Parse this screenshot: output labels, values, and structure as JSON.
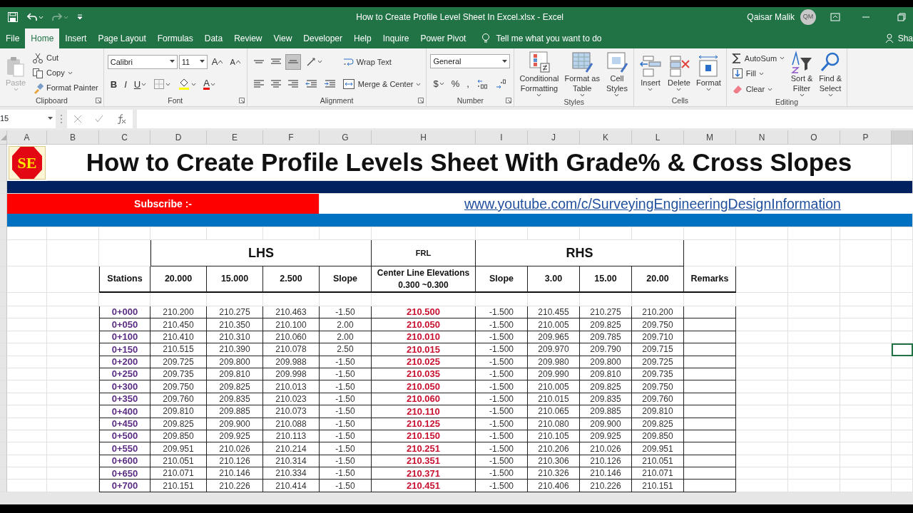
{
  "title_bar": {
    "title": "How to Create Profile Level Sheet In Excel.xlsx  -  Excel",
    "user": "Qaisar Malik",
    "avatar": "QM",
    "undo_enabled": true,
    "redo_enabled": false
  },
  "tabs": [
    {
      "label": "File",
      "selected": false
    },
    {
      "label": "Home",
      "selected": true
    },
    {
      "label": "Insert",
      "selected": false
    },
    {
      "label": "Page Layout",
      "selected": false
    },
    {
      "label": "Formulas",
      "selected": false
    },
    {
      "label": "Data",
      "selected": false
    },
    {
      "label": "Review",
      "selected": false
    },
    {
      "label": "View",
      "selected": false
    },
    {
      "label": "Developer",
      "selected": false
    },
    {
      "label": "Help",
      "selected": false
    },
    {
      "label": "Inquire",
      "selected": false
    },
    {
      "label": "Power Pivot",
      "selected": false
    }
  ],
  "tell_me": "Tell me what you want to do",
  "share": "Sha",
  "ribbon": [
    {
      "label": "Clipboard",
      "columns": [
        [
          [
            {
              "kind": "large",
              "lines": [
                "Paste"
              ],
              "disabled": true
            }
          ]
        ],
        [
          [
            {
              "kind": "small",
              "label": "Cut"
            }
          ],
          [
            {
              "kind": "small",
              "label": "Copy"
            }
          ],
          [
            {
              "kind": "small",
              "label": "Format Painter"
            }
          ]
        ]
      ]
    },
    {
      "label": "Font",
      "columns": [
        [
          [
            {
              "kind": "field",
              "value": "Calibri"
            },
            {
              "kind": "field",
              "value": "11"
            },
            {
              "kind": "glyph",
              "label": "A"
            },
            {
              "kind": "glyph",
              "label": "A"
            }
          ],
          [
            {
              "kind": "glyph",
              "label": "B"
            },
            {
              "kind": "glyph",
              "label": "I"
            },
            {
              "kind": "glyph",
              "label": "U"
            },
            {
              "kind": "icon"
            },
            {
              "kind": "icon"
            },
            {
              "kind": "glyph",
              "label": "A"
            }
          ]
        ]
      ]
    },
    {
      "label": "Alignment",
      "columns": [
        [
          [
            {
              "kind": "icon",
              "selected": false
            },
            {
              "kind": "icon",
              "selected": false
            },
            {
              "kind": "icon",
              "selected": true
            },
            {
              "kind": "icon"
            }
          ],
          [
            {
              "kind": "icon",
              "selected": false
            },
            {
              "kind": "icon",
              "selected": false
            },
            {
              "kind": "icon",
              "selected": false
            },
            {
              "kind": "icon"
            },
            {
              "kind": "icon"
            }
          ]
        ],
        [
          [
            {
              "kind": "small",
              "label": "Wrap Text"
            }
          ],
          [
            {
              "kind": "small",
              "label": "Merge & Center"
            }
          ]
        ]
      ]
    },
    {
      "label": "Number",
      "columns": [
        [
          [
            {
              "kind": "field",
              "value": "General"
            }
          ],
          [
            {
              "kind": "glyph",
              "label": "$"
            },
            {
              "kind": "glyph",
              "label": "%"
            },
            {
              "kind": "glyph",
              "label": ","
            },
            {
              "kind": "icon"
            },
            {
              "kind": "icon"
            }
          ]
        ]
      ]
    },
    {
      "label": "Styles",
      "columns": [
        [
          [
            {
              "kind": "large",
              "lines": [
                "Conditional",
                "Formatting"
              ],
              "disabled": false
            }
          ]
        ],
        [
          [
            {
              "kind": "large",
              "lines": [
                "Format as",
                "Table"
              ],
              "disabled": false
            }
          ]
        ],
        [
          [
            {
              "kind": "large",
              "lines": [
                "Cell",
                "Styles"
              ],
              "disabled": false
            }
          ]
        ]
      ]
    },
    {
      "label": "Cells",
      "columns": [
        [
          [
            {
              "kind": "large",
              "lines": [
                "Insert"
              ],
              "disabled": false
            }
          ]
        ],
        [
          [
            {
              "kind": "large",
              "lines": [
                "Delete"
              ],
              "disabled": false
            }
          ]
        ],
        [
          [
            {
              "kind": "large",
              "lines": [
                "Format"
              ],
              "disabled": false
            }
          ]
        ]
      ]
    },
    {
      "label": "Editing",
      "columns": [
        [
          [
            {
              "kind": "small",
              "label": "AutoSum"
            }
          ],
          [
            {
              "kind": "small",
              "label": "Fill"
            }
          ],
          [
            {
              "kind": "small",
              "label": "Clear"
            }
          ]
        ],
        [
          [
            {
              "kind": "large",
              "lines": [
                "Sort &",
                "Filter"
              ],
              "disabled": false
            }
          ]
        ],
        [
          [
            {
              "kind": "large",
              "lines": [
                "Find &",
                "Select"
              ],
              "disabled": false
            }
          ]
        ]
      ]
    }
  ],
  "name_box": "15",
  "columns": [
    "A",
    "B",
    "C",
    "D",
    "E",
    "F",
    "G",
    "H",
    "I",
    "J",
    "K",
    "L",
    "M",
    "N",
    "O",
    "P"
  ],
  "banner": {
    "logo": "SE",
    "title": "How to Create Profile Levels Sheet With Grade% & Cross Slopes",
    "subscribe": "Subscribe :-",
    "link": "www.youtube.com/c/SurveyingEngineeringDesignInformation"
  },
  "table": {
    "lhs": "LHS",
    "frl": "FRL",
    "rhs": "RHS",
    "stations": "Stations",
    "lhs_columns": [
      "20.000",
      "15.000",
      "2.500",
      "Slope"
    ],
    "center": [
      "Center Line Elevations",
      "0.300 ~0.300"
    ],
    "rhs_columns": [
      "Slope",
      "3.00",
      "15.00",
      "20.00"
    ],
    "remarks": "Remarks",
    "rows": [
      [
        "0+000",
        "210.200",
        "210.275",
        "210.463",
        "-1.50",
        "210.500",
        "-1.500",
        "210.455",
        "210.275",
        "210.200"
      ],
      [
        "0+050",
        "210.450",
        "210.350",
        "210.100",
        "2.00",
        "210.050",
        "-1.500",
        "210.005",
        "209.825",
        "209.750"
      ],
      [
        "0+100",
        "210.410",
        "210.310",
        "210.060",
        "2.00",
        "210.010",
        "-1.500",
        "209.965",
        "209.785",
        "209.710"
      ],
      [
        "0+150",
        "210.515",
        "210.390",
        "210.078",
        "2.50",
        "210.015",
        "-1.500",
        "209.970",
        "209.790",
        "209.715"
      ],
      [
        "0+200",
        "209.725",
        "209.800",
        "209.988",
        "-1.50",
        "210.025",
        "-1.500",
        "209.980",
        "209.800",
        "209.725"
      ],
      [
        "0+250",
        "209.735",
        "209.810",
        "209.998",
        "-1.50",
        "210.035",
        "-1.500",
        "209.990",
        "209.810",
        "209.735"
      ],
      [
        "0+300",
        "209.750",
        "209.825",
        "210.013",
        "-1.50",
        "210.050",
        "-1.500",
        "210.005",
        "209.825",
        "209.750"
      ],
      [
        "0+350",
        "209.760",
        "209.835",
        "210.023",
        "-1.50",
        "210.060",
        "-1.500",
        "210.015",
        "209.835",
        "209.760"
      ],
      [
        "0+400",
        "209.810",
        "209.885",
        "210.073",
        "-1.50",
        "210.110",
        "-1.500",
        "210.065",
        "209.885",
        "209.810"
      ],
      [
        "0+450",
        "209.825",
        "209.900",
        "210.088",
        "-1.50",
        "210.125",
        "-1.500",
        "210.080",
        "209.900",
        "209.825"
      ],
      [
        "0+500",
        "209.850",
        "209.925",
        "210.113",
        "-1.50",
        "210.150",
        "-1.500",
        "210.105",
        "209.925",
        "209.850"
      ],
      [
        "0+550",
        "209.951",
        "210.026",
        "210.214",
        "-1.50",
        "210.251",
        "-1.500",
        "210.206",
        "210.026",
        "209.951"
      ],
      [
        "0+600",
        "210.051",
        "210.126",
        "210.314",
        "-1.50",
        "210.351",
        "-1.500",
        "210.306",
        "210.126",
        "210.051"
      ],
      [
        "0+650",
        "210.071",
        "210.146",
        "210.334",
        "-1.50",
        "210.371",
        "-1.500",
        "210.326",
        "210.146",
        "210.071"
      ],
      [
        "0+700",
        "210.151",
        "210.226",
        "210.414",
        "-1.50",
        "210.451",
        "-1.500",
        "210.406",
        "210.226",
        "210.151"
      ]
    ]
  }
}
